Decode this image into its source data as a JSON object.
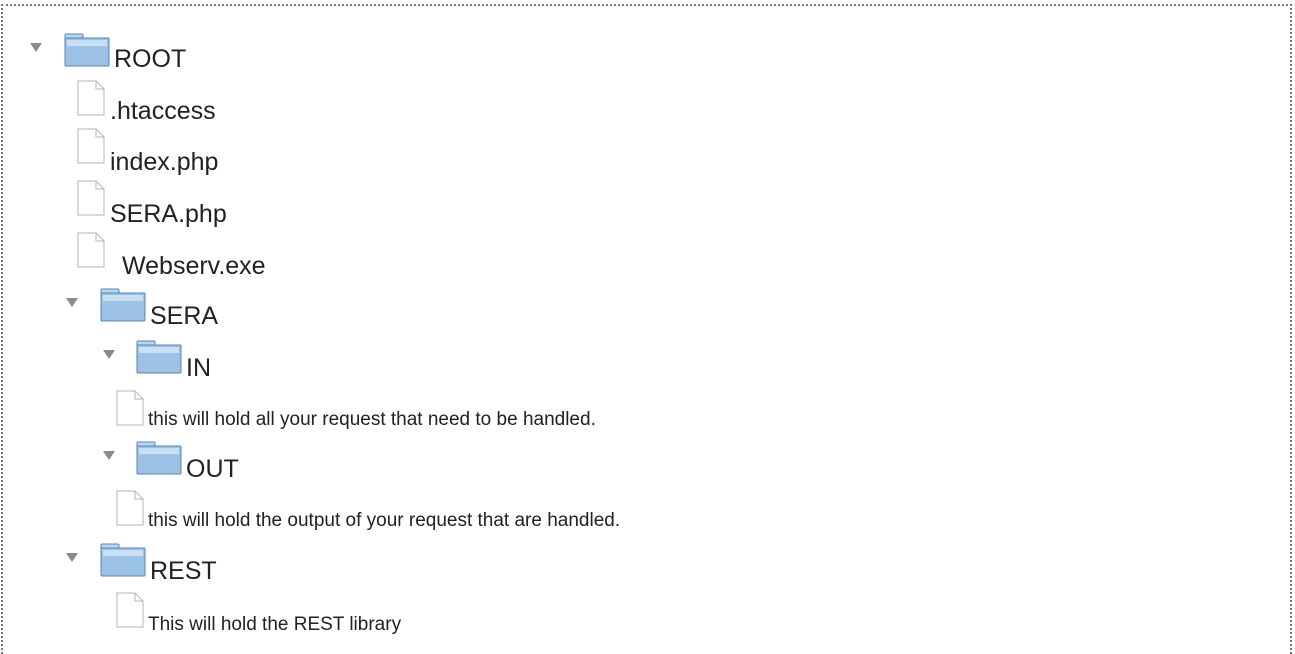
{
  "tree": {
    "root": "ROOT",
    "htaccess": ".htaccess",
    "index": "index.php",
    "sera_php": "SERA.php",
    "webserv": "Webserv.exe",
    "sera": "SERA",
    "in": "IN",
    "in_desc": "this will hold all your request that need to be handled.",
    "out": "OUT",
    "out_desc": "this will hold the output of your request that are handled.",
    "rest": "REST",
    "rest_desc": "This will hold the REST library"
  },
  "icons": {
    "folder": "folder-icon",
    "file": "file-icon",
    "expand": "expand-triangle-icon"
  },
  "colors": {
    "folder_fill": "#9cc3e6",
    "folder_edge": "#5a86b0",
    "triangle": "#8a8a8a",
    "border": "#777777"
  }
}
